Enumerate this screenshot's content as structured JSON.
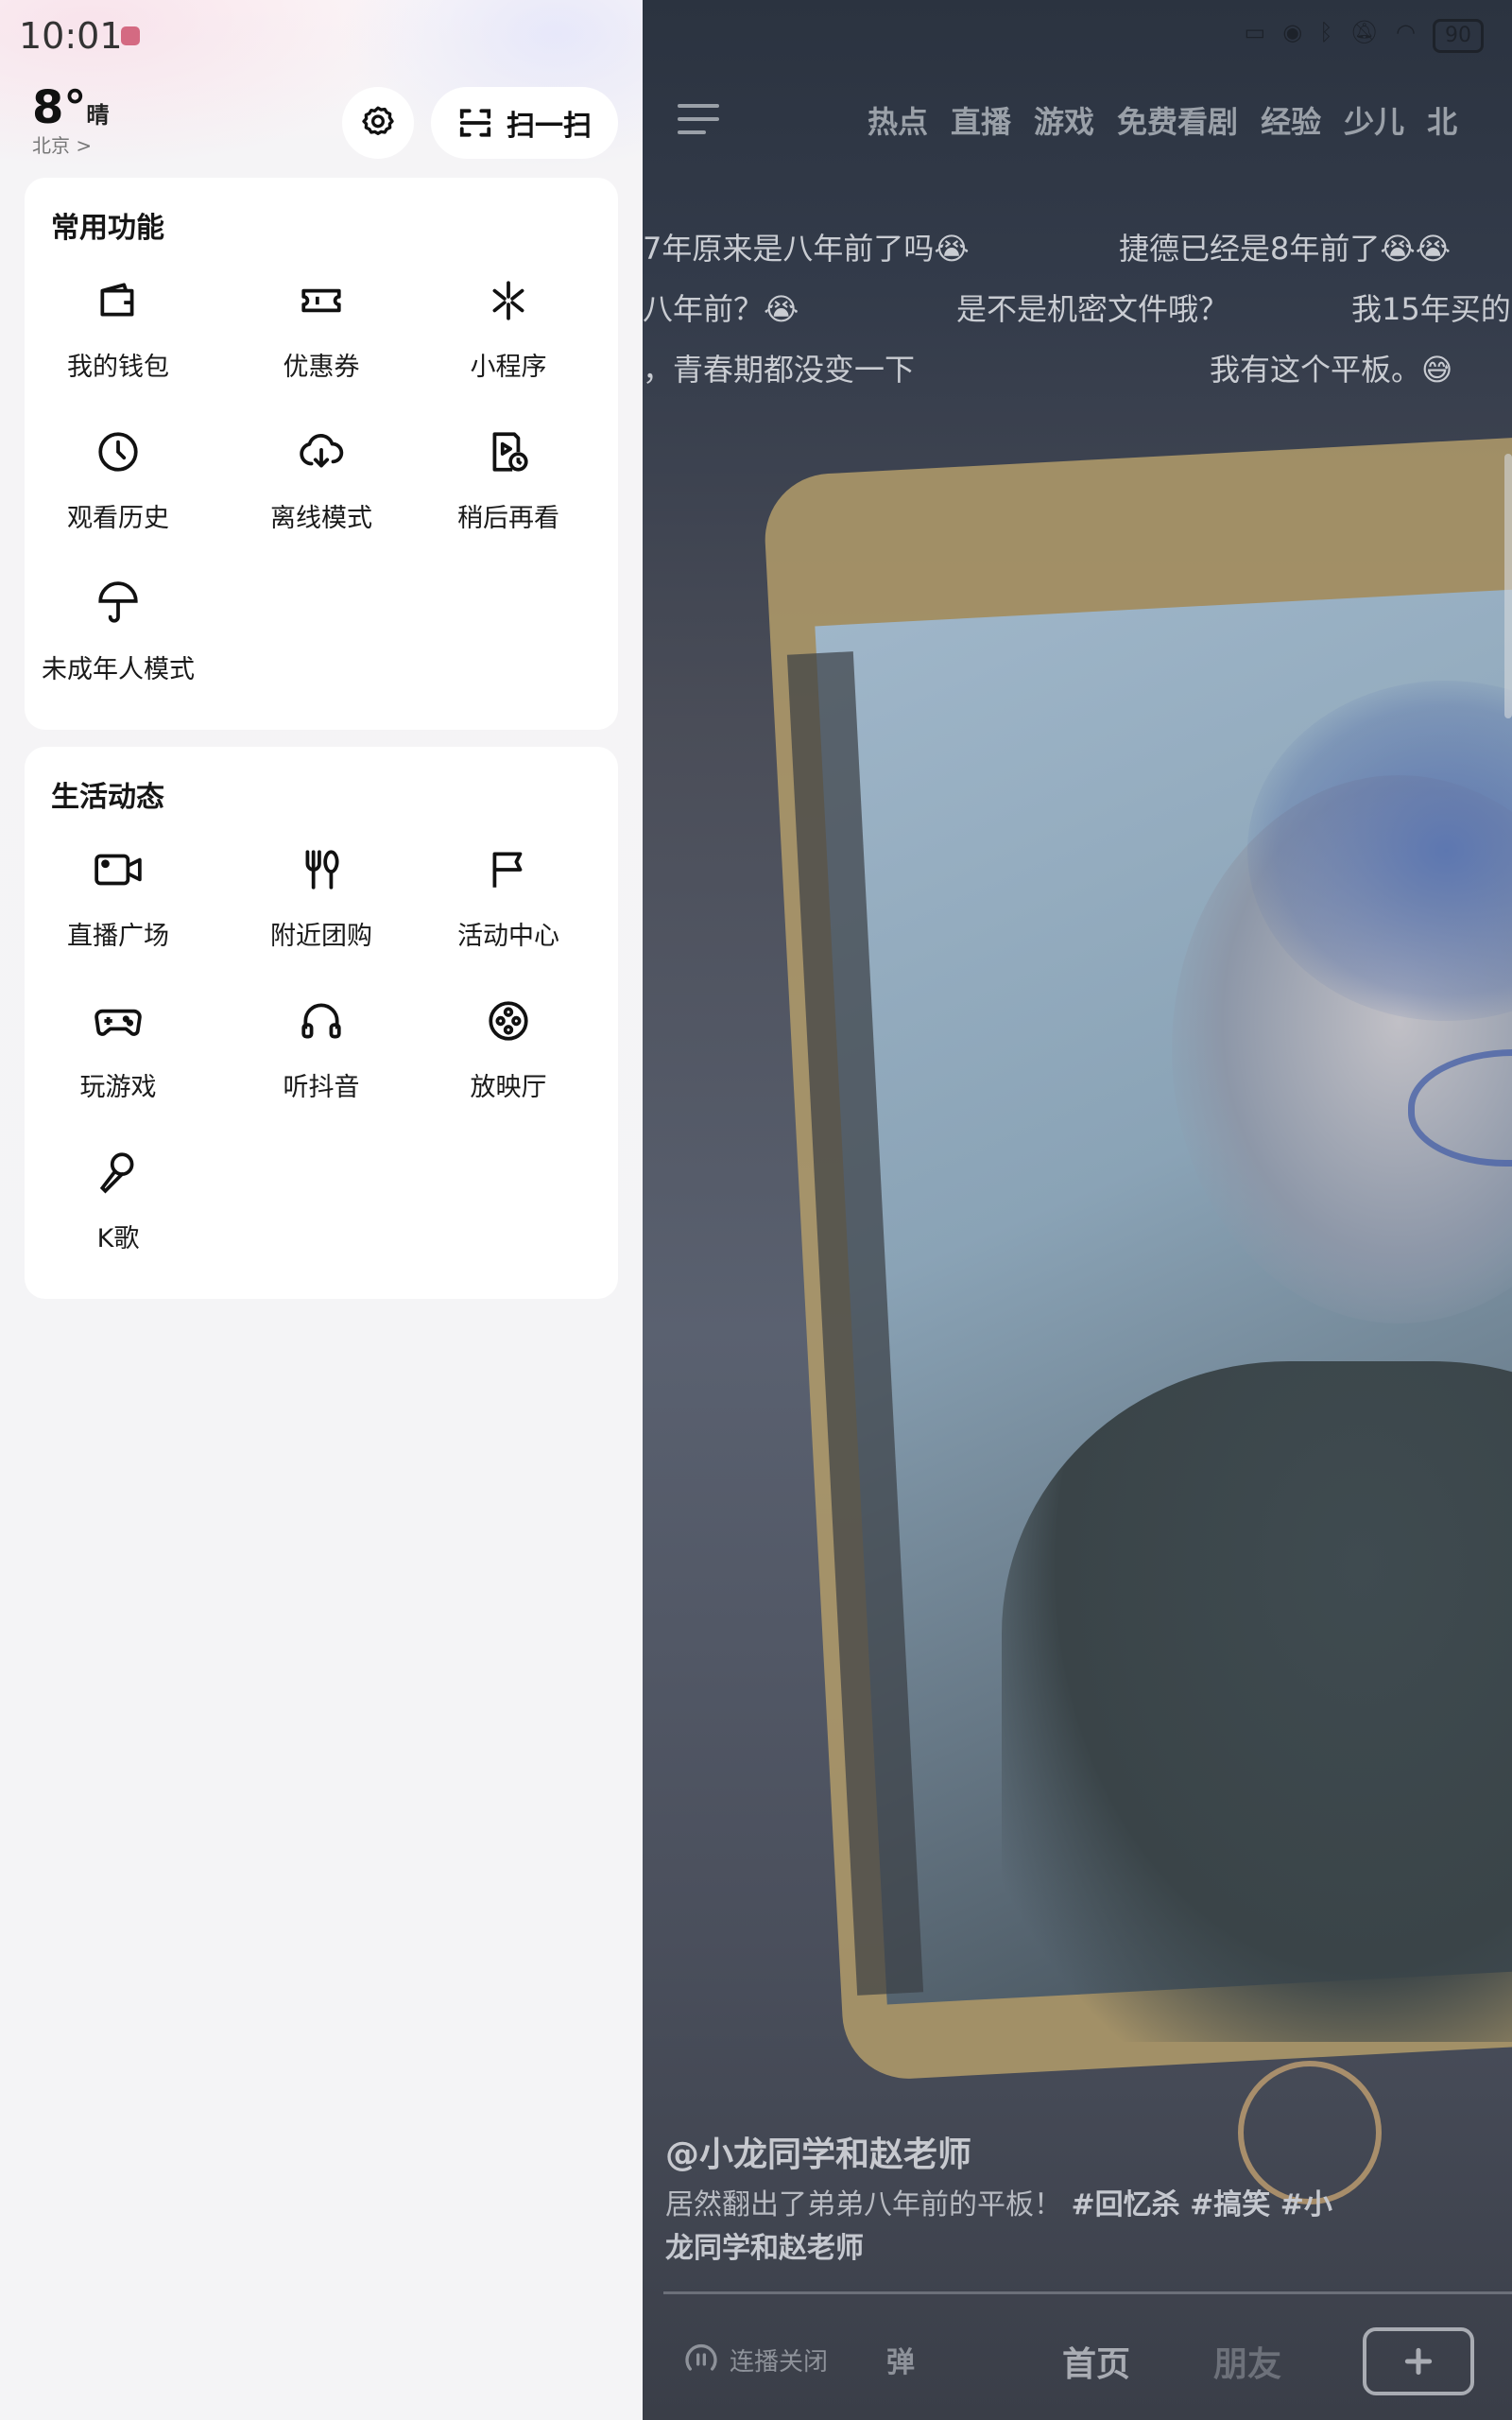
{
  "status": {
    "time": "10:01",
    "battery": "90"
  },
  "weather": {
    "temp": "8°",
    "condition": "晴",
    "city": "北京 >"
  },
  "drawer": {
    "scan_label": "扫一扫",
    "common": {
      "title": "常用功能",
      "items": [
        {
          "label": "我的钱包",
          "icon": "wallet-icon"
        },
        {
          "label": "优惠券",
          "icon": "coupon-icon"
        },
        {
          "label": "小程序",
          "icon": "mini-program-icon"
        },
        {
          "label": "观看历史",
          "icon": "clock-icon"
        },
        {
          "label": "离线模式",
          "icon": "cloud-download-icon"
        },
        {
          "label": "稍后再看",
          "icon": "watch-later-icon"
        },
        {
          "label": "未成年人模式",
          "icon": "umbrella-icon"
        }
      ]
    },
    "life": {
      "title": "生活动态",
      "items": [
        {
          "label": "直播广场",
          "icon": "live-camera-icon"
        },
        {
          "label": "附近团购",
          "icon": "fork-knife-icon"
        },
        {
          "label": "活动中心",
          "icon": "flag-icon"
        },
        {
          "label": "玩游戏",
          "icon": "gamepad-icon"
        },
        {
          "label": "听抖音",
          "icon": "headphones-icon"
        },
        {
          "label": "放映厅",
          "icon": "film-reel-icon"
        },
        {
          "label": "K歌",
          "icon": "microphone-icon"
        }
      ]
    }
  },
  "video": {
    "tabs": [
      "热点",
      "直播",
      "游戏",
      "免费看剧",
      "经验",
      "少儿",
      "北"
    ],
    "danmaku": [
      "7年原来是八年前了吗😭",
      "捷德已经是8年前了😭😭",
      "八年前？😭",
      "是不是机密文件哦？",
      "我15年买的",
      "，青春期都没变一下",
      "我有这个平板。😅"
    ],
    "author": "@小龙同学和赵老师",
    "description": "居然翻出了弟弟八年前的平板！",
    "hashtags": "#回忆杀 #搞笑 #小",
    "description_line2": "龙同学和赵老师",
    "autoplay_label": "连播关闭",
    "danmaku_toggle": "弹",
    "nav_home": "首页",
    "nav_friends": "朋友"
  },
  "colors": {
    "accent": "#4a63a8",
    "drawer_bg": "#f4f4f6",
    "card_bg": "#ffffff"
  }
}
